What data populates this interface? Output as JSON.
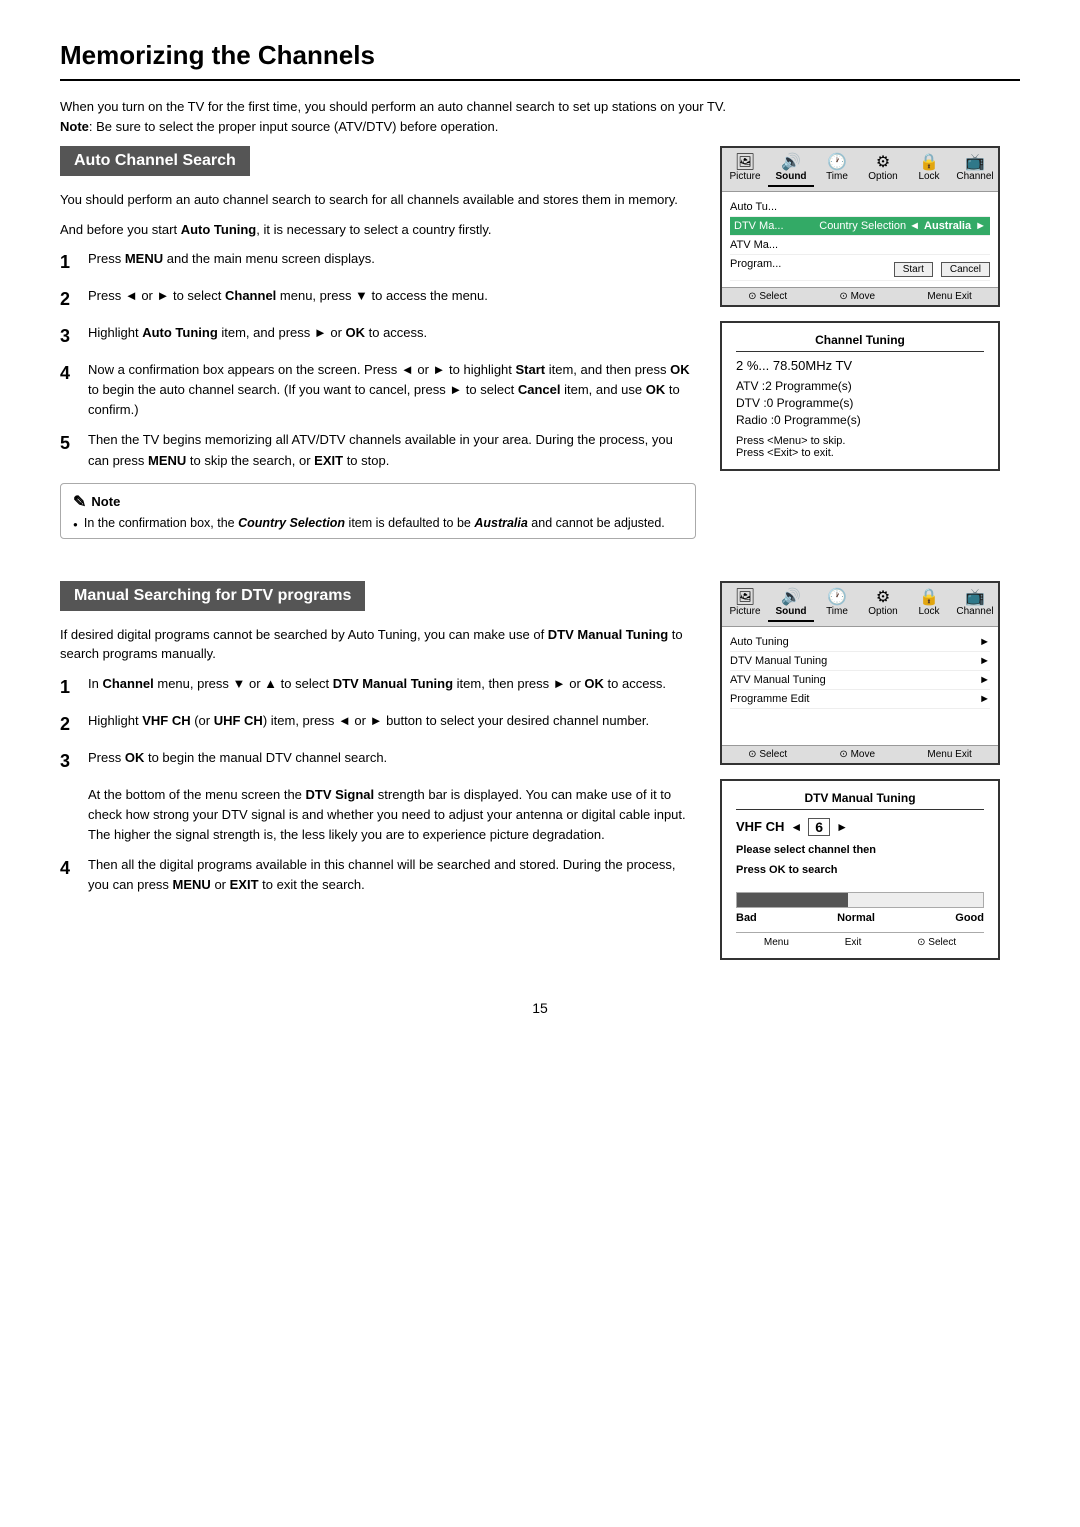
{
  "page": {
    "title": "Memorizing the Channels",
    "page_number": "15"
  },
  "intro": {
    "line1": "When you turn on the TV for the first time, you should perform an auto channel search to set up stations on your TV.",
    "line2_label": "Note",
    "line2": ": Be sure to select the proper input source (ATV/DTV) before operation."
  },
  "section1": {
    "header": "Auto Channel Search",
    "desc": "You should perform an auto channel search to search for all channels available and stores them in memory.",
    "desc2": "And before you start Auto Tuning, it is necessary to select a country firstly.",
    "steps": [
      {
        "num": "1",
        "text": "Press MENU and the main menu screen displays."
      },
      {
        "num": "2",
        "text": "Press ◄ or ► to select Channel menu,  press ▼ to access the menu."
      },
      {
        "num": "3",
        "text": "Highlight Auto Tuning item, and press ► or OK to access."
      },
      {
        "num": "4",
        "text": "Now a confirmation box appears on the screen. Press ◄ or ► to highlight Start item, and then press OK to begin the auto channel search. (If you want to cancel, press ► to select Cancel item, and use OK to confirm.)"
      },
      {
        "num": "5",
        "text": "Then the TV begins memorizing all ATV/DTV channels available in your area. During the process, you can press MENU to skip the search, or EXIT to stop."
      }
    ],
    "note": {
      "title": "Note",
      "bullet": "In the confirmation box, the Country Selection item is defaulted to be Australia and cannot be adjusted."
    }
  },
  "tv_ui1": {
    "tabs": [
      "Picture",
      "Sound",
      "Time",
      "Option",
      "Lock",
      "Channel"
    ],
    "active_tab": "Channel",
    "rows": [
      {
        "label": "Auto Tu...",
        "value": ""
      },
      {
        "label": "DTV Ma...",
        "highlight": true,
        "country_sel": true,
        "country": "Australia"
      },
      {
        "label": "ATV Ma...",
        "value": ""
      },
      {
        "label": "Program...",
        "value": ""
      }
    ],
    "confirm": {
      "start": "Start",
      "cancel": "Cancel"
    },
    "footer": [
      "Select",
      "Move",
      "Exit"
    ]
  },
  "tuning_box": {
    "title": "Channel  Tuning",
    "freq": "2 %...  78.50MHz  TV",
    "rows": [
      "ATV  :2  Programme(s)",
      "DTV  :0  Programme(s)",
      "Radio  :0  Programme(s)"
    ],
    "footer1": "Press <Menu> to skip.",
    "footer2": "Press <Exit> to exit."
  },
  "section2": {
    "header": "Manual Searching for DTV programs",
    "desc": "If desired digital programs cannot be searched by Auto Tuning, you can make use of DTV Manual Tuning to search programs manually.",
    "steps": [
      {
        "num": "1",
        "text": "In Channel menu,  press ▼ or ▲  to select DTV Manual Tuning item, then press ► or OK to access."
      },
      {
        "num": "2",
        "text": "Highlight VHF CH (or UHF CH) item, press ◄ or ► button to select your desired channel number."
      },
      {
        "num": "3",
        "text": "Press OK to begin the manual DTV channel search."
      },
      {
        "num": "4",
        "text_parts": [
          "At the bottom of the menu screen the ",
          "DTV Signal",
          " strength bar is displayed. You can make use of it to check how strong your DTV signal is and whether you need to adjust your antenna or digital cable input. The higher the signal strength is, the less likely you are to experience picture degradation."
        ]
      },
      {
        "num": "4b",
        "text": "Then all the digital programs available in this channel will be searched and stored. During the process, you can press MENU or EXIT to exit the search."
      }
    ]
  },
  "tv_ui2": {
    "tabs": [
      "Picture",
      "Sound",
      "Time",
      "Option",
      "Lock",
      "Channel"
    ],
    "active_tab": "Channel",
    "rows": [
      {
        "label": "Auto Tuning",
        "arrow": true
      },
      {
        "label": "DTV Manual Tuning",
        "arrow": true
      },
      {
        "label": "ATV Manual Tuning",
        "arrow": true
      },
      {
        "label": "Programme Edit",
        "arrow": true
      }
    ],
    "footer": [
      "Select",
      "Move",
      "Exit"
    ]
  },
  "dtv_box": {
    "title": "DTV Manual Tuning",
    "ch_label": "VHF  CH",
    "ch_left": "◄",
    "ch_num": "6",
    "ch_right": "►",
    "msg1": "Please select channel then",
    "msg2": "Press OK to search",
    "signal_labels": [
      "Bad",
      "Normal",
      "Good"
    ],
    "signal_pct": 45,
    "footer": [
      "Menu",
      "Exit",
      "Select"
    ]
  }
}
